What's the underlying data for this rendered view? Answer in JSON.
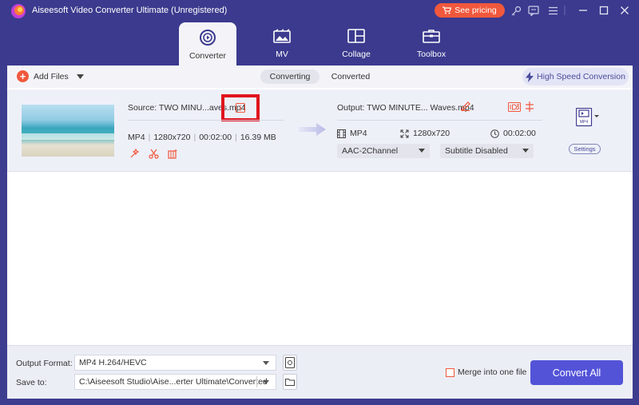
{
  "app": {
    "title": "Aiseesoft Video Converter Ultimate (Unregistered)",
    "pricing_label": "See pricing",
    "accent_color": "#3b3a8e",
    "orange_color": "#f1583c"
  },
  "tabs": [
    {
      "label": "Converter",
      "icon": "converter-icon",
      "active": true
    },
    {
      "label": "MV",
      "icon": "mv-icon",
      "active": false
    },
    {
      "label": "Collage",
      "icon": "collage-icon",
      "active": false
    },
    {
      "label": "Toolbox",
      "icon": "toolbox-icon",
      "active": false
    }
  ],
  "toolbar": {
    "add_files_label": "Add Files",
    "converting_label": "Converting",
    "converted_label": "Converted",
    "high_speed_label": "High Speed Conversion"
  },
  "file": {
    "source_label": "Source: TWO MINU...aves.mp4",
    "format": "MP4",
    "resolution": "1280x720",
    "duration": "00:02:00",
    "size": "16.39 MB",
    "output_label": "Output: TWO MINUTE... Waves.mp4",
    "out_format": "MP4",
    "out_resolution": "1280x720",
    "out_duration": "00:02:00",
    "audio_track": "AAC-2Channel",
    "subtitle": "Subtitle Disabled",
    "format_badge": "MP4",
    "settings_label": "Settings"
  },
  "bottom": {
    "output_format_label": "Output Format:",
    "output_format_value": "MP4 H.264/HEVC",
    "save_to_label": "Save to:",
    "save_to_value": "C:\\Aiseesoft Studio\\Aise...erter Ultimate\\Converted",
    "merge_label": "Merge into one file",
    "convert_all_label": "Convert All"
  }
}
